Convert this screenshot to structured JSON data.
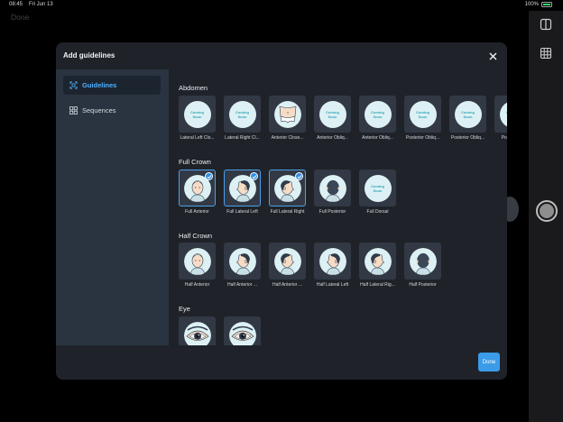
{
  "status_bar": {
    "time": "08:45",
    "date": "Fri Jun 13",
    "battery": "100%"
  },
  "background": {
    "done_label": "Done"
  },
  "modal": {
    "title": "Add guidelines",
    "close_icon": "close-icon",
    "sidebar": [
      {
        "label": "Guidelines",
        "icon": "guideline-frame-icon",
        "active": true
      },
      {
        "label": "Sequences",
        "icon": "grid-icon",
        "active": false
      }
    ],
    "sections": [
      {
        "title": "Abdomen",
        "tiles": [
          {
            "label": "Lateral Left Clo...",
            "coming_soon": true,
            "coming_text": [
              "Coming",
              "Soon"
            ],
            "selected": false
          },
          {
            "label": "Lateral Right Cl...",
            "coming_soon": true,
            "coming_text": [
              "Coming",
              "Soon"
            ],
            "selected": false
          },
          {
            "label": "Anterior Close...",
            "coming_soon": false,
            "icon": "abdomen-icon",
            "selected": false
          },
          {
            "label": "Anterior Obliq...",
            "coming_soon": true,
            "coming_text": [
              "Coming",
              "Soon"
            ],
            "selected": false
          },
          {
            "label": "Anterior Obliq...",
            "coming_soon": true,
            "coming_text": [
              "Coming",
              "Soon"
            ],
            "selected": false
          },
          {
            "label": "Posterior Obliq...",
            "coming_soon": true,
            "coming_text": [
              "Coming",
              "Soon"
            ],
            "selected": false
          },
          {
            "label": "Posterior Obliq...",
            "coming_soon": true,
            "coming_text": [
              "Coming",
              "Soon"
            ],
            "selected": false
          },
          {
            "label": "Posterior ...",
            "coming_soon": true,
            "coming_text": [
              "Coming",
              "Soon"
            ],
            "selected": false
          }
        ]
      },
      {
        "title": "Full Crown",
        "tiles": [
          {
            "label": "Full Anterior",
            "coming_soon": false,
            "icon": "head-front-icon",
            "selected": true
          },
          {
            "label": "Full Lateral Left",
            "coming_soon": false,
            "icon": "head-left-icon",
            "selected": true
          },
          {
            "label": "Full Lateral Right",
            "coming_soon": false,
            "icon": "head-right-icon",
            "selected": true
          },
          {
            "label": "Full Posterior",
            "coming_soon": false,
            "icon": "head-back-icon",
            "selected": false
          },
          {
            "label": "Full Dorsal",
            "coming_soon": true,
            "coming_text": [
              "Coming",
              "Soon"
            ],
            "selected": false
          }
        ]
      },
      {
        "title": "Half Crown",
        "tiles": [
          {
            "label": "Half Anterior",
            "coming_soon": false,
            "icon": "head-front-icon",
            "selected": false
          },
          {
            "label": "Half Anterior ...",
            "coming_soon": false,
            "icon": "head-left-icon",
            "selected": false
          },
          {
            "label": "Half Anterior ...",
            "coming_soon": false,
            "icon": "head-right-icon",
            "selected": false
          },
          {
            "label": "Half Lateral Left",
            "coming_soon": false,
            "icon": "head-left-icon",
            "selected": false
          },
          {
            "label": "Half Lateral Rig...",
            "coming_soon": false,
            "icon": "head-right-icon",
            "selected": false
          },
          {
            "label": "Half Posterior",
            "coming_soon": false,
            "icon": "head-back-icon",
            "selected": false
          }
        ]
      },
      {
        "title": "Eye",
        "tiles": [
          {
            "label": "",
            "coming_soon": false,
            "icon": "eye-icon",
            "selected": false
          },
          {
            "label": "",
            "coming_soon": false,
            "icon": "eye-icon",
            "selected": false
          }
        ]
      }
    ],
    "done_label": "Done"
  },
  "colors": {
    "accent": "#3b9be8",
    "modal_bg": "#1f2329",
    "sidebar_bg": "#293440",
    "tile_bg": "#323945"
  }
}
